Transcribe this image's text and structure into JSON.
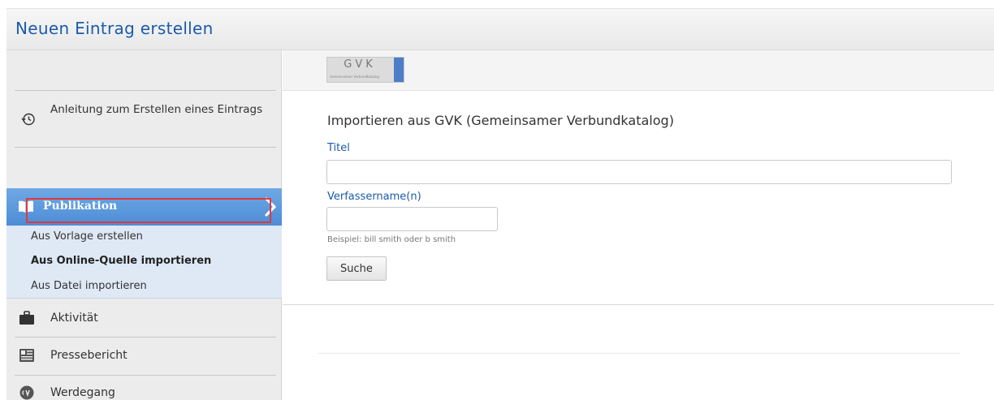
{
  "header": {
    "title": "Neuen Eintrag erstellen"
  },
  "sidebar": {
    "guide": {
      "label": "Anleitung zum Erstellen eines Eintrags",
      "icon": "history-icon"
    },
    "publication": {
      "label": "Publikation",
      "icon": "open-book-icon",
      "accent_color": "#5b98dc",
      "subitems": [
        {
          "label": "Aus Vorlage erstellen"
        },
        {
          "label": "Aus Online-Quelle importieren",
          "active": true
        },
        {
          "label": "Aus Datei importieren"
        }
      ]
    },
    "items": [
      {
        "label": "Aktivität",
        "icon": "briefcase-icon"
      },
      {
        "label": "Pressebericht",
        "icon": "press-card-icon"
      },
      {
        "label": "Werdegang",
        "icon": "cv-icon"
      }
    ]
  },
  "logo": {
    "text": "GVK",
    "subtext": "Gemeinsamer Verbundkatalog",
    "accent_color": "#4d7cc8"
  },
  "form": {
    "heading": "Importieren aus GVK (Gemeinsamer Verbundkatalog)",
    "title_label": "Titel",
    "title_value": "",
    "author_label": "Verfassername(n)",
    "author_value": "",
    "author_hint": "Beispiel: bill smith oder b smith",
    "search_button": "Suche",
    "label_color": "#1b5bab"
  },
  "highlight": {
    "color": "#e0393b"
  }
}
